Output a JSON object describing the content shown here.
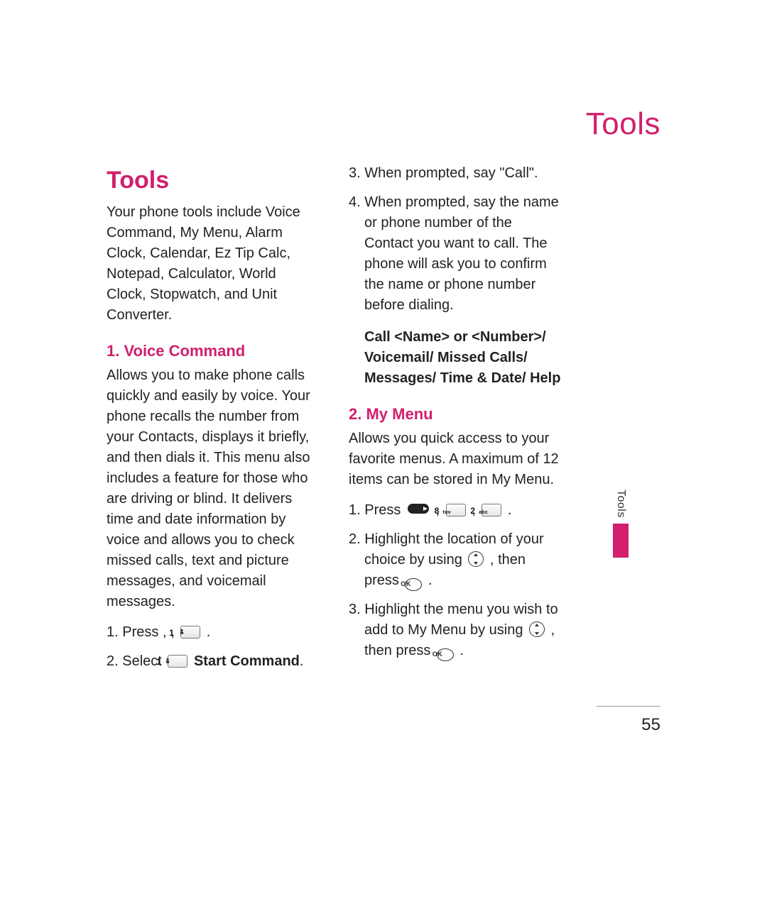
{
  "running_head": "Tools",
  "sections": {
    "tools": {
      "heading": "Tools",
      "intro": "Your phone tools include Voice Command, My Menu, Alarm Clock, Calendar, Ez Tip Calc, Notepad, Calculator, World Clock, Stopwatch, and Unit Converter."
    },
    "voice_command": {
      "heading": "1. Voice Command",
      "intro": "Allows you to make phone calls quickly and easily by voice. Your phone recalls the number from your Contacts, displays it briefly, and then dials it. This menu also includes a feature for those who are driving or blind. It delivers time and date information by voice and allows you to check missed calls, text and picture messages, and voicemail messages.",
      "steps": {
        "s1_a": "Press ",
        "s1_b": " , ",
        "s1_c": " , ",
        "s1_d": " .",
        "s2_a": "Select ",
        "s2_b": " Start Command",
        "s2_c": ".",
        "s3": "When prompted, say \"Call\".",
        "s4": "When prompted, say the name or phone number of the Contact you want to call. The phone will ask you to confirm the name or phone number before dialing."
      },
      "bold_block": "Call <Name> or <Number>/ Voicemail/ Missed Calls/ Messages/ Time & Date/ Help"
    },
    "my_menu": {
      "heading": "2. My Menu",
      "intro": "Allows you quick access to your favorite menus. A maximum of 12 items can be stored in My Menu.",
      "steps": {
        "s1_a": "Press ",
        "s1_b": " , ",
        "s1_c": " , ",
        "s1_d": " .",
        "s2_a": "Highlight the location of your choice by using ",
        "s2_b": " , then press ",
        "s2_c": " .",
        "s3_a": "Highlight the menu you wish to add to My Menu by using ",
        "s3_b": " , then press ",
        "s3_c": " ."
      }
    }
  },
  "keys": {
    "one": {
      "digit": "1",
      "letters": ""
    },
    "two": {
      "digit": "2",
      "letters": "abc"
    },
    "eight": {
      "digit": "8",
      "letters": "tuv"
    },
    "ok_label": "OK"
  },
  "side_tab": "Tools",
  "page_number": "55"
}
